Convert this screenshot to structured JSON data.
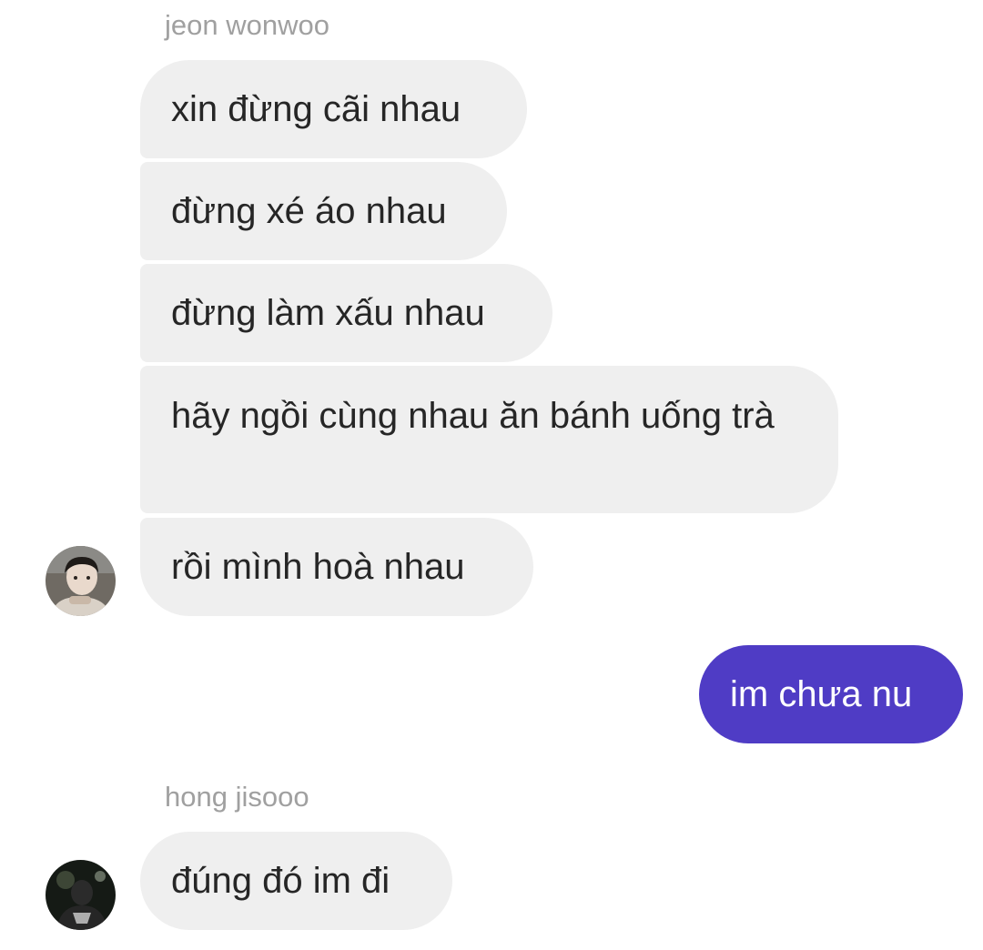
{
  "thread": {
    "group1": {
      "sender": "jeon wonwoo",
      "avatar_icon": "profile-photo-icon",
      "messages": [
        "xin đừng cãi nhau",
        "đừng xé áo nhau",
        "đừng làm xấu nhau",
        "hãy ngồi cùng nhau ăn bánh uống trà",
        "rồi mình hoà nhau"
      ]
    },
    "outgoing": {
      "messages": [
        "im chưa nu"
      ],
      "bubble_color": "#4f3cc5"
    },
    "group2": {
      "sender": "hong jisooo",
      "avatar_icon": "profile-photo-icon",
      "messages": [
        "đúng đó im đi"
      ]
    }
  },
  "colors": {
    "incoming_bubble": "#efefef",
    "incoming_text": "#262626",
    "outgoing_text": "#ffffff",
    "sender_name": "#a0a0a0"
  }
}
